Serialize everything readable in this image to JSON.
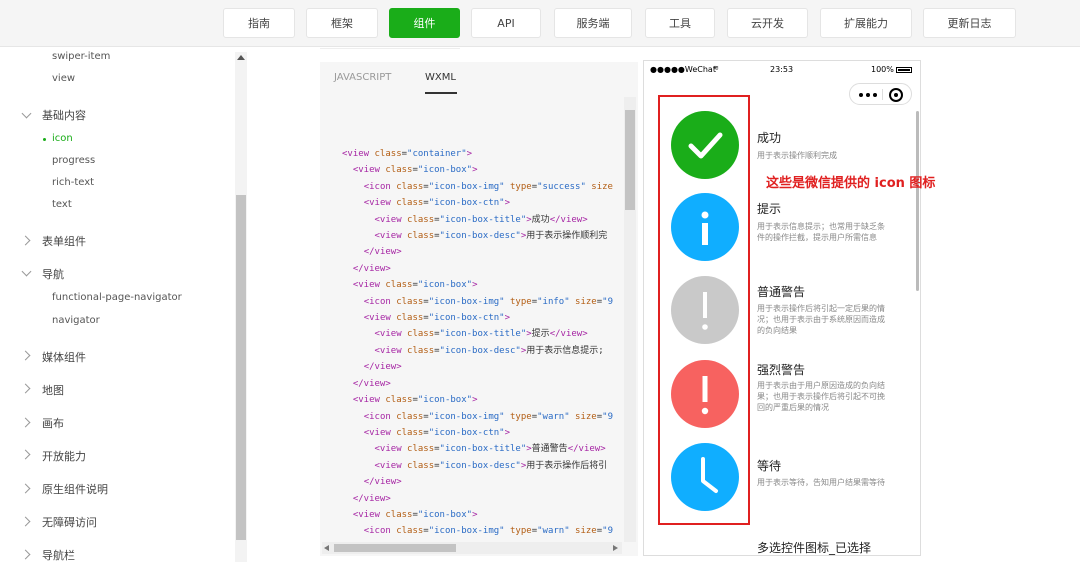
{
  "topnav": {
    "items": [
      "指南",
      "框架",
      "组件",
      "API",
      "服务端",
      "工具",
      "云开发",
      "扩展能力",
      "更新日志"
    ],
    "active": "组件"
  },
  "sidebar": {
    "items": {
      "swiper_item": "swiper-item",
      "view": "view",
      "basic": "基础内容",
      "icon": "icon",
      "progress": "progress",
      "rich_text": "rich-text",
      "text": "text",
      "form": "表单组件",
      "nav": "导航",
      "functional_page_navigator": "functional-page-navigator",
      "navigator": "navigator",
      "media": "媒体组件",
      "map": "地图",
      "canvas": "画布",
      "open": "开放能力",
      "native": "原生组件说明",
      "a11y": "无障碍访问",
      "navbar": "导航栏"
    }
  },
  "code_panel": {
    "tabs": [
      "JAVASCRIPT",
      "WXML"
    ],
    "active_tab": "WXML",
    "lines": [
      {
        "parts": [
          [
            "tg",
            "<view "
          ],
          [
            "at",
            "class"
          ],
          [
            "tx",
            "="
          ],
          [
            "st",
            "\"container\""
          ],
          [
            "tg",
            ">"
          ]
        ]
      },
      {
        "parts": [
          [
            "tx",
            "  "
          ],
          [
            "tg",
            "<view "
          ],
          [
            "at",
            "class"
          ],
          [
            "tx",
            "="
          ],
          [
            "st",
            "\"icon-box\""
          ],
          [
            "tg",
            ">"
          ]
        ]
      },
      {
        "parts": [
          [
            "tx",
            "    "
          ],
          [
            "tg",
            "<icon "
          ],
          [
            "at",
            "class"
          ],
          [
            "tx",
            "="
          ],
          [
            "st",
            "\"icon-box-img\" "
          ],
          [
            "at",
            "type"
          ],
          [
            "tx",
            "="
          ],
          [
            "st",
            "\"success\" "
          ],
          [
            "at",
            "size"
          ]
        ]
      },
      {
        "parts": [
          [
            "tx",
            "    "
          ],
          [
            "tg",
            "<view "
          ],
          [
            "at",
            "class"
          ],
          [
            "tx",
            "="
          ],
          [
            "st",
            "\"icon-box-ctn\""
          ],
          [
            "tg",
            ">"
          ]
        ]
      },
      {
        "parts": [
          [
            "tx",
            "      "
          ],
          [
            "tg",
            "<view "
          ],
          [
            "at",
            "class"
          ],
          [
            "tx",
            "="
          ],
          [
            "st",
            "\"icon-box-title\""
          ],
          [
            "tg",
            ">"
          ],
          [
            "tx",
            "成功"
          ],
          [
            "tg",
            "</view>"
          ]
        ]
      },
      {
        "parts": [
          [
            "tx",
            "      "
          ],
          [
            "tg",
            "<view "
          ],
          [
            "at",
            "class"
          ],
          [
            "tx",
            "="
          ],
          [
            "st",
            "\"icon-box-desc\""
          ],
          [
            "tg",
            ">"
          ],
          [
            "tx",
            "用于表示操作顺利完"
          ]
        ]
      },
      {
        "parts": [
          [
            "tx",
            "    "
          ],
          [
            "tg",
            "</view>"
          ]
        ]
      },
      {
        "parts": [
          [
            "tx",
            "  "
          ],
          [
            "tg",
            "</view>"
          ]
        ]
      },
      {
        "parts": [
          [
            "tx",
            "  "
          ],
          [
            "tg",
            "<view "
          ],
          [
            "at",
            "class"
          ],
          [
            "tx",
            "="
          ],
          [
            "st",
            "\"icon-box\""
          ],
          [
            "tg",
            ">"
          ]
        ]
      },
      {
        "parts": [
          [
            "tx",
            "    "
          ],
          [
            "tg",
            "<icon "
          ],
          [
            "at",
            "class"
          ],
          [
            "tx",
            "="
          ],
          [
            "st",
            "\"icon-box-img\" "
          ],
          [
            "at",
            "type"
          ],
          [
            "tx",
            "="
          ],
          [
            "st",
            "\"info\" "
          ],
          [
            "at",
            "size"
          ],
          [
            "tx",
            "="
          ],
          [
            "st",
            "\"9"
          ]
        ]
      },
      {
        "parts": [
          [
            "tx",
            "    "
          ],
          [
            "tg",
            "<view "
          ],
          [
            "at",
            "class"
          ],
          [
            "tx",
            "="
          ],
          [
            "st",
            "\"icon-box-ctn\""
          ],
          [
            "tg",
            ">"
          ]
        ]
      },
      {
        "parts": [
          [
            "tx",
            "      "
          ],
          [
            "tg",
            "<view "
          ],
          [
            "at",
            "class"
          ],
          [
            "tx",
            "="
          ],
          [
            "st",
            "\"icon-box-title\""
          ],
          [
            "tg",
            ">"
          ],
          [
            "tx",
            "提示"
          ],
          [
            "tg",
            "</view>"
          ]
        ]
      },
      {
        "parts": [
          [
            "tx",
            "      "
          ],
          [
            "tg",
            "<view "
          ],
          [
            "at",
            "class"
          ],
          [
            "tx",
            "="
          ],
          [
            "st",
            "\"icon-box-desc\""
          ],
          [
            "tg",
            ">"
          ],
          [
            "tx",
            "用于表示信息提示;"
          ]
        ]
      },
      {
        "parts": [
          [
            "tx",
            "    "
          ],
          [
            "tg",
            "</view>"
          ]
        ]
      },
      {
        "parts": [
          [
            "tx",
            "  "
          ],
          [
            "tg",
            "</view>"
          ]
        ]
      },
      {
        "parts": [
          [
            "tx",
            "  "
          ],
          [
            "tg",
            "<view "
          ],
          [
            "at",
            "class"
          ],
          [
            "tx",
            "="
          ],
          [
            "st",
            "\"icon-box\""
          ],
          [
            "tg",
            ">"
          ]
        ]
      },
      {
        "parts": [
          [
            "tx",
            "    "
          ],
          [
            "tg",
            "<icon "
          ],
          [
            "at",
            "class"
          ],
          [
            "tx",
            "="
          ],
          [
            "st",
            "\"icon-box-img\" "
          ],
          [
            "at",
            "type"
          ],
          [
            "tx",
            "="
          ],
          [
            "st",
            "\"warn\" "
          ],
          [
            "at",
            "size"
          ],
          [
            "tx",
            "="
          ],
          [
            "st",
            "\"9"
          ]
        ]
      },
      {
        "parts": [
          [
            "tx",
            "    "
          ],
          [
            "tg",
            "<view "
          ],
          [
            "at",
            "class"
          ],
          [
            "tx",
            "="
          ],
          [
            "st",
            "\"icon-box-ctn\""
          ],
          [
            "tg",
            ">"
          ]
        ]
      },
      {
        "parts": [
          [
            "tx",
            "      "
          ],
          [
            "tg",
            "<view "
          ],
          [
            "at",
            "class"
          ],
          [
            "tx",
            "="
          ],
          [
            "st",
            "\"icon-box-title\""
          ],
          [
            "tg",
            ">"
          ],
          [
            "tx",
            "普通警告"
          ],
          [
            "tg",
            "</view>"
          ]
        ]
      },
      {
        "parts": [
          [
            "tx",
            "      "
          ],
          [
            "tg",
            "<view "
          ],
          [
            "at",
            "class"
          ],
          [
            "tx",
            "="
          ],
          [
            "st",
            "\"icon-box-desc\""
          ],
          [
            "tg",
            ">"
          ],
          [
            "tx",
            "用于表示操作后将引"
          ]
        ]
      },
      {
        "parts": [
          [
            "tx",
            "    "
          ],
          [
            "tg",
            "</view>"
          ]
        ]
      },
      {
        "parts": [
          [
            "tx",
            "  "
          ],
          [
            "tg",
            "</view>"
          ]
        ]
      },
      {
        "parts": [
          [
            "tx",
            "  "
          ],
          [
            "tg",
            "<view "
          ],
          [
            "at",
            "class"
          ],
          [
            "tx",
            "="
          ],
          [
            "st",
            "\"icon-box\""
          ],
          [
            "tg",
            ">"
          ]
        ]
      },
      {
        "parts": [
          [
            "tx",
            "    "
          ],
          [
            "tg",
            "<icon "
          ],
          [
            "at",
            "class"
          ],
          [
            "tx",
            "="
          ],
          [
            "st",
            "\"icon-box-img\" "
          ],
          [
            "at",
            "type"
          ],
          [
            "tx",
            "="
          ],
          [
            "st",
            "\"warn\" "
          ],
          [
            "at",
            "size"
          ],
          [
            "tx",
            "="
          ],
          [
            "st",
            "\"9"
          ]
        ]
      }
    ]
  },
  "phone": {
    "carrier": "●●●●●WeChat",
    "time": "23:53",
    "battery": "100%",
    "icons": [
      {
        "type": "success",
        "color": "#1aad19",
        "title": "成功",
        "desc": "用于表示操作顺利完成"
      },
      {
        "type": "info",
        "color": "#10aeff",
        "title": "提示",
        "desc": "用于表示信息提示；也常用于缺乏条件的操作拦截，提示用户所需信息"
      },
      {
        "type": "warn",
        "color": "#c9c9c9",
        "title": "普通警告",
        "desc": "用于表示操作后将引起一定后果的情况；也用于表示由于系统原因而造成的负向结果"
      },
      {
        "type": "warn",
        "color": "#f76260",
        "title": "强烈警告",
        "desc": "用于表示由于用户原因造成的负向结果；也用于表示操作后将引起不可挽回的严重后果的情况"
      },
      {
        "type": "waiting",
        "color": "#10aeff",
        "title": "等待",
        "desc": "用于表示等待，告知用户结果需等待"
      }
    ],
    "bottom_title": "多选控件图标_已选择"
  },
  "annotation": "这些是微信提供的 icon 图标"
}
